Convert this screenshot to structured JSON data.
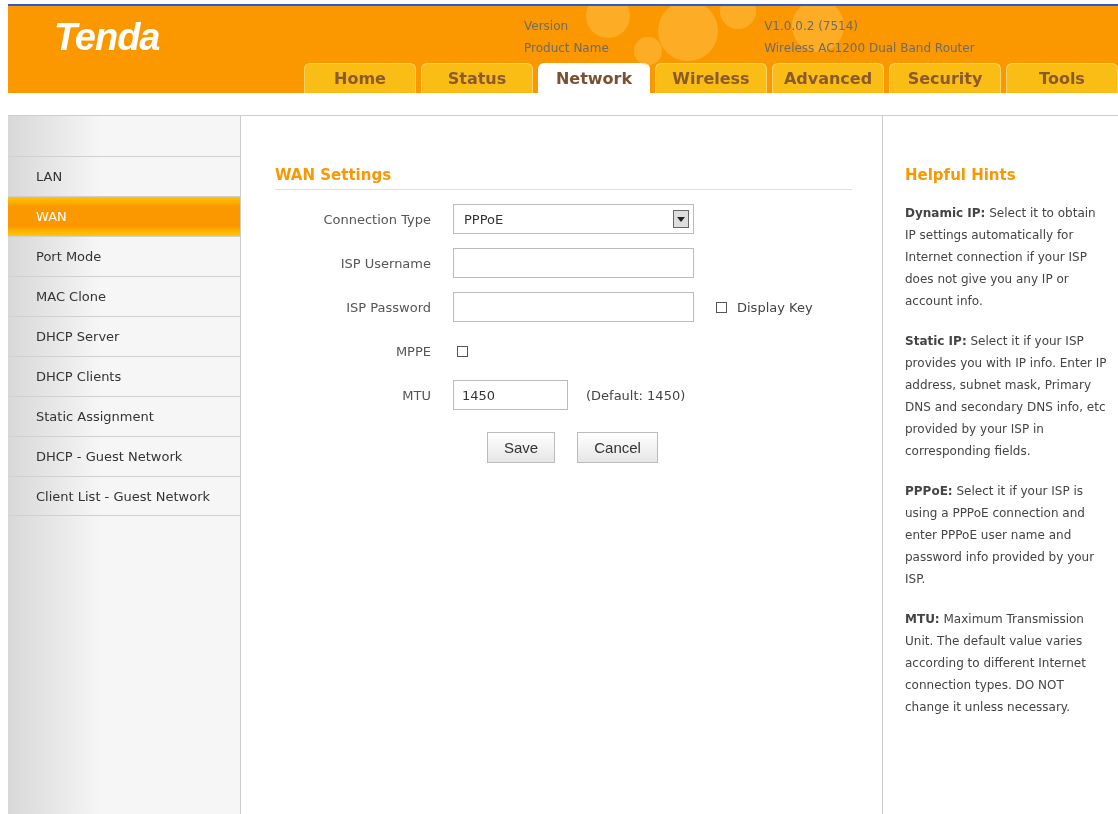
{
  "header": {
    "logo": "Tenda",
    "version_label": "Version",
    "version": "V1.0.0.2 (7514)",
    "product_label": "Product Name",
    "product": "Wireless AC1200 Dual Band Router"
  },
  "tabs": [
    {
      "label": "Home",
      "selected": false
    },
    {
      "label": "Status",
      "selected": false
    },
    {
      "label": "Network",
      "selected": true
    },
    {
      "label": "Wireless",
      "selected": false
    },
    {
      "label": "Advanced",
      "selected": false
    },
    {
      "label": "Security",
      "selected": false
    },
    {
      "label": "Tools",
      "selected": false
    }
  ],
  "sidebar": {
    "items": [
      {
        "label": "LAN",
        "selected": false
      },
      {
        "label": "WAN",
        "selected": true
      },
      {
        "label": "Port Mode",
        "selected": false
      },
      {
        "label": "MAC Clone",
        "selected": false
      },
      {
        "label": "DHCP Server",
        "selected": false
      },
      {
        "label": "DHCP Clients",
        "selected": false
      },
      {
        "label": "Static Assignment",
        "selected": false
      },
      {
        "label": "DHCP - Guest Network",
        "selected": false
      },
      {
        "label": "Client List - Guest Network",
        "selected": false
      }
    ]
  },
  "form": {
    "title": "WAN Settings",
    "fields": [
      {
        "kind": "select",
        "label": "Connection Type",
        "value": "PPPoE"
      },
      {
        "kind": "text",
        "label": "ISP Username"
      },
      {
        "kind": "password",
        "label": "ISP Password",
        "option": {
          "label": "Display Key",
          "checked": false
        }
      },
      {
        "kind": "checkbox",
        "label": "MPPE",
        "checked": false
      },
      {
        "kind": "short",
        "label": "MTU",
        "value": "1450",
        "note": "(Default: 1450)"
      }
    ],
    "buttons": [
      "Save",
      "Cancel"
    ]
  },
  "hints": {
    "title": "Helpful Hints",
    "items": [
      "**Dynamic IP:** Select it to obtain IP settings automatically for Internet connection if your ISP does not give you any IP or account info.",
      "**Static IP:** Select it if your ISP provides you with IP info. Enter IP address, subnet mask, Primary DNS and secondary DNS info, etc provided by your ISP in corresponding fields.",
      "**PPPoE:** Select it if your ISP is using a PPPoE connection and enter PPPoE user name and password info provided by your ISP.",
      "**MTU:** Maximum Transmission Unit. The default value varies according to different Internet connection types. DO NOT change it unless necessary."
    ]
  }
}
